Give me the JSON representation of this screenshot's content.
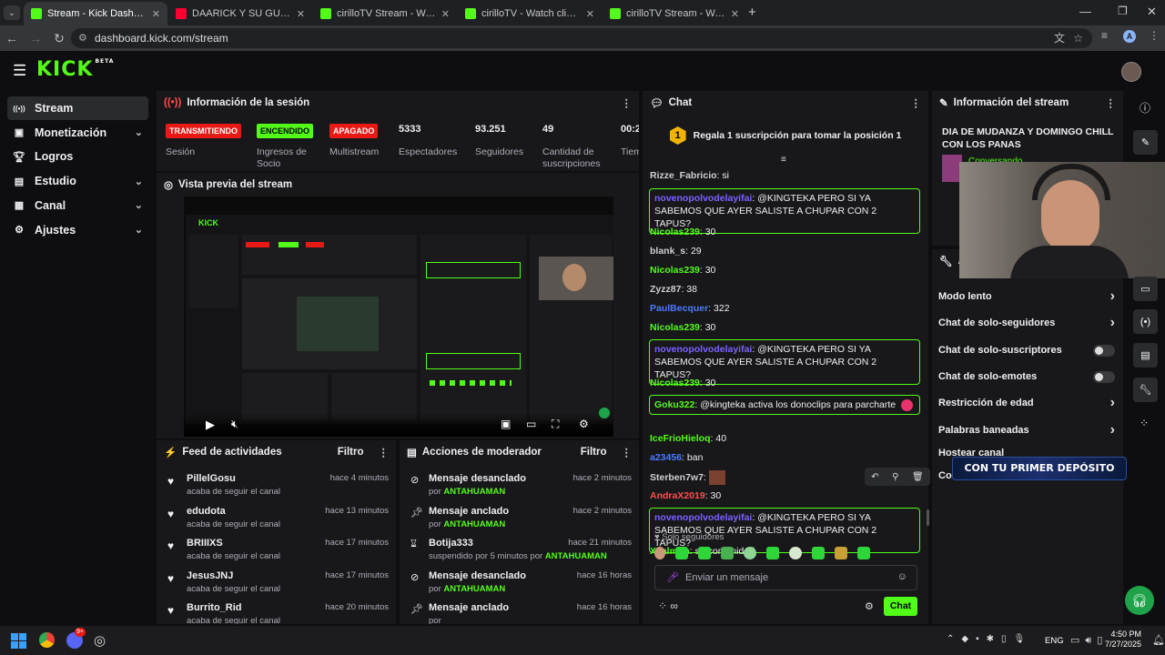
{
  "browser": {
    "tabs": [
      {
        "title": "Stream - Kick Dashboard",
        "icon": "kick-favicon",
        "active": true
      },
      {
        "title": "DAARICK Y SU GUSTO POR LAS",
        "icon": "youtube-favicon",
        "active": false
      },
      {
        "title": "cirilloTV Stream - Watch Live on",
        "icon": "kick-favicon",
        "active": false
      },
      {
        "title": "cirilloTV - Watch clips on Kick",
        "icon": "kick-favicon",
        "active": false
      },
      {
        "title": "cirilloTV Stream - Watch Live on",
        "icon": "kick-favicon",
        "active": false
      }
    ],
    "url": "dashboard.kick.com/stream"
  },
  "app": {
    "logo": "KICK",
    "logo_tag": "BETA"
  },
  "sidebar": {
    "items": [
      {
        "label": "Stream",
        "icon": "broadcast-icon",
        "active": true
      },
      {
        "label": "Monetización",
        "icon": "money-icon",
        "chevron": true
      },
      {
        "label": "Logros",
        "icon": "trophy-icon"
      },
      {
        "label": "Estudio",
        "icon": "studio-icon",
        "chevron": true
      },
      {
        "label": "Canal",
        "icon": "channel-icon",
        "chevron": true
      },
      {
        "label": "Ajustes",
        "icon": "gear-icon",
        "chevron": true
      }
    ]
  },
  "session": {
    "title": "Información de la sesión",
    "stats": [
      {
        "value": "TRANSMITIENDO",
        "label": "Sesión",
        "type": "badge",
        "color": "#e91916"
      },
      {
        "value": "ENCENDIDO",
        "label": "Ingresos de Socio",
        "type": "badge",
        "color": "#53fc18"
      },
      {
        "value": "APAGADO",
        "label": "Multistream",
        "type": "badge",
        "color": "#e91916"
      },
      {
        "value": "5333",
        "label": "Espectadores"
      },
      {
        "value": "93.251",
        "label": "Seguidores"
      },
      {
        "value": "49",
        "label": "Cantidad de suscripciones"
      },
      {
        "value": "00:2",
        "label": "Tiem en vi"
      }
    ]
  },
  "preview": {
    "title": "Vista previa del stream"
  },
  "feed": {
    "title": "Feed de actividades",
    "filter": "Filtro",
    "items": [
      {
        "name": "PillelGosu",
        "sub": "acaba de seguir el canal",
        "time": "hace 4 minutos"
      },
      {
        "name": "edudota",
        "sub": "acaba de seguir el canal",
        "time": "hace 13 minutos"
      },
      {
        "name": "BRIIIXS",
        "sub": "acaba de seguir el canal",
        "time": "hace 17 minutos"
      },
      {
        "name": "JesusJNJ",
        "sub": "acaba de seguir el canal",
        "time": "hace 17 minutos"
      },
      {
        "name": "Burrito_Rid",
        "sub": "acaba de seguir el canal",
        "time": "hace 20 minutos"
      }
    ]
  },
  "modactions": {
    "title": "Acciones de moderador",
    "filter": "Filtro",
    "items": [
      {
        "title": "Mensaje desanclado",
        "pre": "por",
        "who": "ANTAHUAMAN",
        "time": "hace 2 minutos",
        "icon": "unpin-icon"
      },
      {
        "title": "Mensaje anclado",
        "pre": "por",
        "who": "ANTAHUAMAN",
        "time": "hace 2 minutos",
        "icon": "pin-icon"
      },
      {
        "title": "Botija333",
        "pre": "suspendido por 5 minutos por",
        "who": "ANTAHUAMAN",
        "time": "hace 21 minutos",
        "icon": "hourglass-icon"
      },
      {
        "title": "Mensaje desanclado",
        "pre": "por",
        "who": "ANTAHUAMAN",
        "time": "hace 16 horas",
        "icon": "unpin-icon"
      },
      {
        "title": "Mensaje anclado",
        "pre": "por",
        "who": "",
        "time": "hace 16 horas",
        "icon": "pin-icon"
      }
    ]
  },
  "chat": {
    "title": "Chat",
    "promo_rank": "1",
    "promo": "Regala 1 suscripción para tomar la posición 1",
    "messages": [
      {
        "user": "Rizze_Fabricio",
        "color": "#cfcfd4",
        "text": "si"
      },
      {
        "user": "novenopolvodelayifai",
        "color": "#7a62ff",
        "text": "@KINGTEKA PERO SI YA SABEMOS QUE AYER SALISTE A CHUPAR CON 2 TAPUS?",
        "highlight": true
      },
      {
        "user": "Nicolas239",
        "color": "#53fc18",
        "text": "30"
      },
      {
        "user": "blank_s",
        "color": "#cfcfd4",
        "text": "29"
      },
      {
        "user": "Nicolas239",
        "color": "#53fc18",
        "text": "30"
      },
      {
        "user": "Zyzz87",
        "color": "#cfcfd4",
        "text": "38"
      },
      {
        "user": "PaulBecquer",
        "color": "#4a7bff",
        "text": "322"
      },
      {
        "user": "Nicolas239",
        "color": "#53fc18",
        "text": "30"
      },
      {
        "user": "novenopolvodelayifai",
        "color": "#7a62ff",
        "text": "@KINGTEKA PERO SI YA SABEMOS QUE AYER SALISTE A CHUPAR CON 2 TAPUS?",
        "highlight": true
      },
      {
        "user": "Nicolas239",
        "color": "#53fc18",
        "text": "30"
      },
      {
        "user": "Goku322",
        "color": "#53fc18",
        "text": "@kingteka activa los donoclips para parcharte",
        "highlight": true
      },
      {
        "user": "IceFrioHieloq",
        "color": "#53fc18",
        "text": "40"
      },
      {
        "user": "a23456",
        "color": "#4a7bff",
        "text": "ban"
      },
      {
        "user": "Sterben7w7",
        "color": "#cfcfd4",
        "text": ""
      },
      {
        "user": "AndraX2019",
        "color": "#ff4d4d",
        "text": "30"
      },
      {
        "user": "novenopolvodelayifai",
        "color": "#7a62ff",
        "text": "@KINGTEKA PERO SI YA SABEMOS QUE AYER SALISTE A CHUPAR CON 2 TAPUS?",
        "highlight": true
      },
      {
        "user": "X5almon",
        "color": "#53fc18",
        "text": "su comunidad"
      }
    ],
    "mode": "Solo seguidores",
    "placeholder": "Enviar un mensaje",
    "send": "Chat"
  },
  "streaminfo": {
    "title": "Información del stream",
    "stream_title": "DIA DE MUDANZA Y DOMINGO CHILL CON LOS PANAS",
    "category": "Conversando"
  },
  "chatsettings": {
    "title": "Ac",
    "items": [
      {
        "label": "Modo lento",
        "type": "chevron"
      },
      {
        "label": "Chat de solo-seguidores",
        "type": "chevron"
      },
      {
        "label": "Chat de solo-suscriptores",
        "type": "toggle"
      },
      {
        "label": "Chat de solo-emotes",
        "type": "toggle"
      },
      {
        "label": "Restricción de edad",
        "type": "chevron"
      },
      {
        "label": "Palabras baneadas",
        "type": "chevron"
      },
      {
        "label": "Hostear canal",
        "type": "none"
      },
      {
        "label": "Co",
        "type": "none"
      }
    ]
  },
  "overlay": {
    "banner": "CON TU PRIMER DEPÓSITO"
  },
  "taskbar": {
    "lang": "ENG",
    "time": "4:50 PM",
    "date": "7/27/2025",
    "badge": "9+"
  }
}
